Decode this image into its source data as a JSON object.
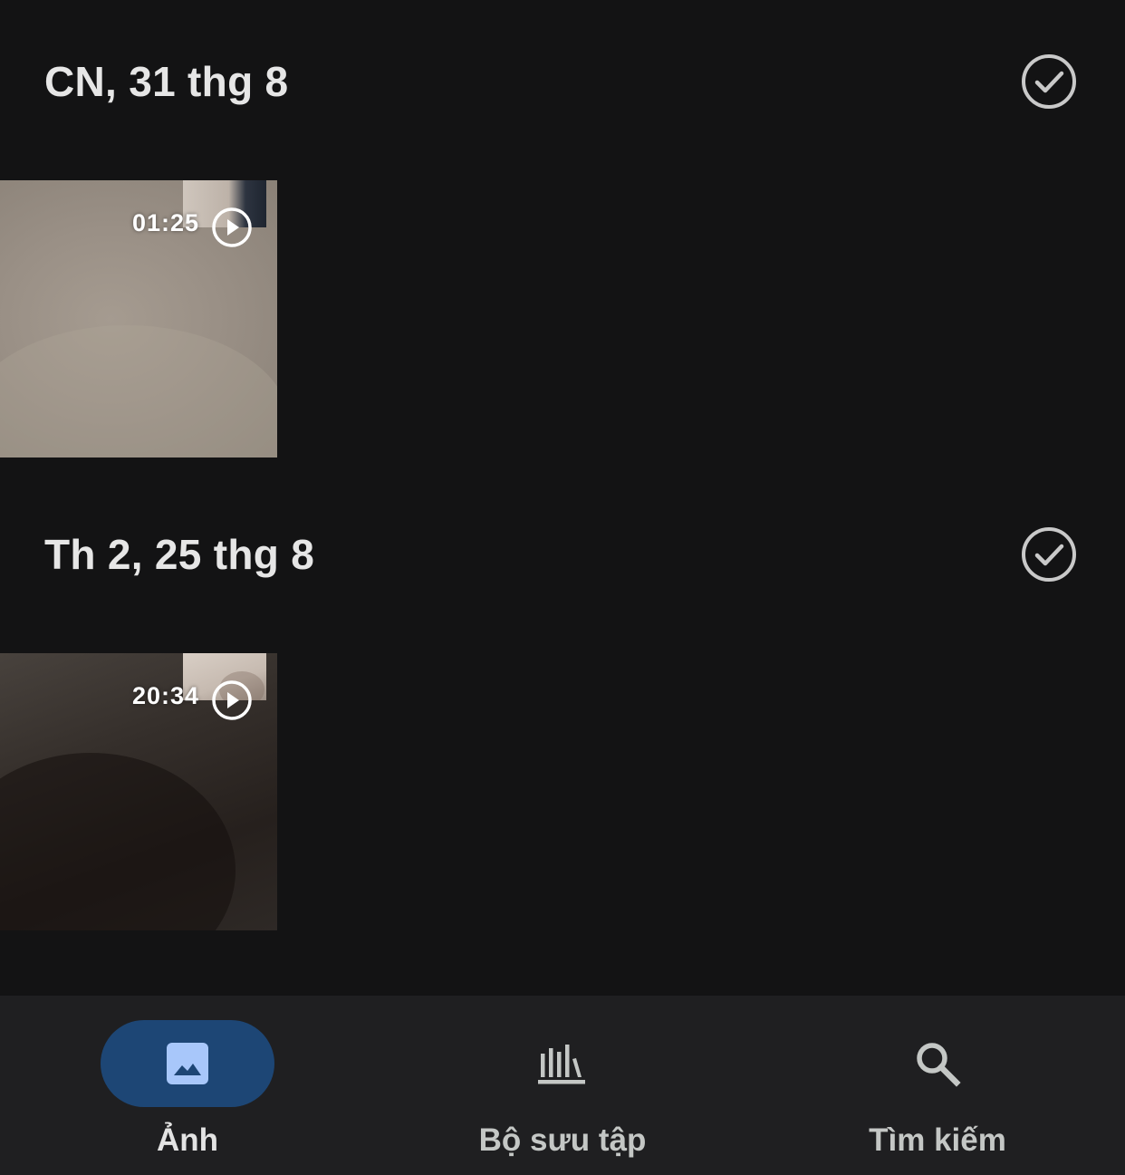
{
  "sections": [
    {
      "date_label": "CN, 31 thg 8",
      "select_icon": "check-circle-icon",
      "items": [
        {
          "type": "video",
          "duration": "01:25",
          "icon": "play-circle-icon"
        }
      ]
    },
    {
      "date_label": "Th 2, 25 thg 8",
      "select_icon": "check-circle-icon",
      "items": [
        {
          "type": "video",
          "duration": "20:34",
          "icon": "play-circle-icon"
        }
      ]
    }
  ],
  "bottom_nav": {
    "items": [
      {
        "label": "Ảnh",
        "icon": "photo-icon",
        "active": true
      },
      {
        "label": "Bộ sưu tập",
        "icon": "library-icon",
        "active": false
      },
      {
        "label": "Tìm kiếm",
        "icon": "search-icon",
        "active": false
      }
    ]
  },
  "colors": {
    "background": "#131314",
    "nav_background": "#1f1f21",
    "active_pill": "#1d4675",
    "active_icon": "#a8c7fa",
    "text_primary": "#e3e3e3",
    "text_secondary": "#c4c7c5"
  }
}
